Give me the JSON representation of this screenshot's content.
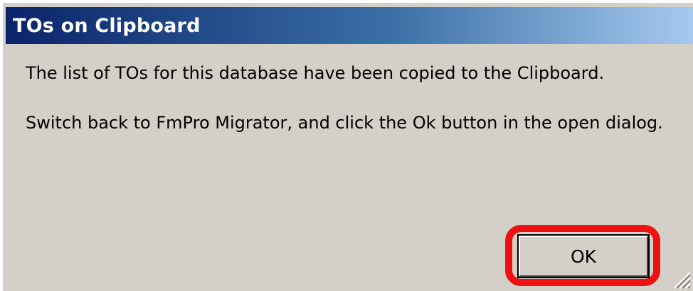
{
  "dialog": {
    "title": "TOs on Clipboard",
    "message_line_1": "The list of TOs for this database have been copied to the Clipboard.",
    "message_line_2": "Switch back to FmPro Migrator, and click the Ok button in the open dialog.",
    "ok_label": "OK"
  },
  "colors": {
    "titlebar_start": "#0a246a",
    "titlebar_end": "#a6caf0",
    "dialog_background": "#d4d0c8",
    "highlight": "#ee1111"
  },
  "icons": {
    "resize_grip": "resize-grip-icon"
  }
}
